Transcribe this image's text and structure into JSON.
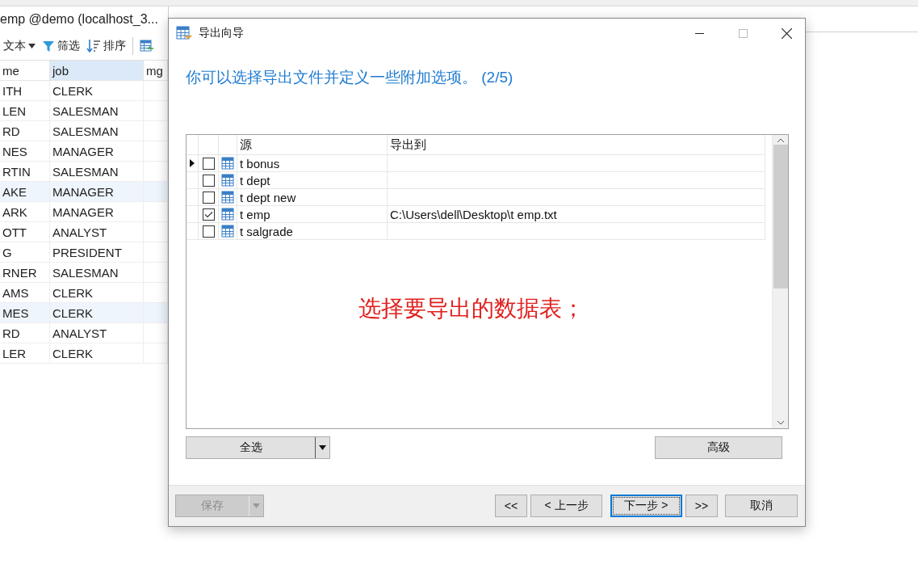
{
  "background_app": {
    "tab_title": "emp @demo (localhost_3...",
    "toolbar": [
      {
        "kind": "dropdown",
        "label": "文本"
      },
      {
        "kind": "filter",
        "label": "筛选"
      },
      {
        "kind": "sort",
        "label": "排序"
      },
      {
        "kind": "table"
      }
    ],
    "grid": {
      "columns": [
        {
          "label": "me",
          "selected": false
        },
        {
          "label": "job",
          "selected": true
        },
        {
          "label": "mg",
          "selected": false
        }
      ],
      "rows": [
        {
          "name": "ITH",
          "job": "CLERK",
          "selected": false
        },
        {
          "name": "LEN",
          "job": "SALESMAN",
          "selected": false
        },
        {
          "name": "RD",
          "job": "SALESMAN",
          "selected": false
        },
        {
          "name": "NES",
          "job": "MANAGER",
          "selected": false
        },
        {
          "name": "RTIN",
          "job": "SALESMAN",
          "selected": false
        },
        {
          "name": "AKE",
          "job": "MANAGER",
          "selected": true
        },
        {
          "name": "ARK",
          "job": "MANAGER",
          "selected": false
        },
        {
          "name": "OTT",
          "job": "ANALYST",
          "selected": false
        },
        {
          "name": "G",
          "job": "PRESIDENT",
          "selected": false
        },
        {
          "name": "RNER",
          "job": "SALESMAN",
          "selected": false
        },
        {
          "name": "AMS",
          "job": "CLERK",
          "selected": false
        },
        {
          "name": "MES",
          "job": "CLERK",
          "selected": true
        },
        {
          "name": "RD",
          "job": "ANALYST",
          "selected": false
        },
        {
          "name": "LER",
          "job": "CLERK",
          "selected": false
        }
      ]
    }
  },
  "dialog": {
    "title": "导出向导",
    "heading": "你可以选择导出文件并定义一些附加选项。 (2/5)",
    "table": {
      "columns": [
        "源",
        "导出到"
      ],
      "rows": [
        {
          "current": true,
          "checked": false,
          "source": "t bonus",
          "target": ""
        },
        {
          "current": false,
          "checked": false,
          "source": "t dept",
          "target": ""
        },
        {
          "current": false,
          "checked": false,
          "source": "t dept new",
          "target": ""
        },
        {
          "current": false,
          "checked": true,
          "source": "t emp",
          "target": "C:\\Users\\dell\\Desktop\\t emp.txt"
        },
        {
          "current": false,
          "checked": false,
          "source": "t salgrade",
          "target": ""
        }
      ]
    },
    "annotation": "选择要导出的数据表；",
    "select_all_button": "全选",
    "advanced_button": "高级",
    "save_button": {
      "label": "保存",
      "disabled": true
    },
    "nav_buttons": [
      {
        "label": "<<",
        "default": false
      },
      {
        "label": "< 上一步",
        "default": false
      },
      {
        "label": "下一步 >",
        "default": true
      },
      {
        "label": ">>",
        "default": false
      }
    ],
    "cancel_button": "取消"
  }
}
